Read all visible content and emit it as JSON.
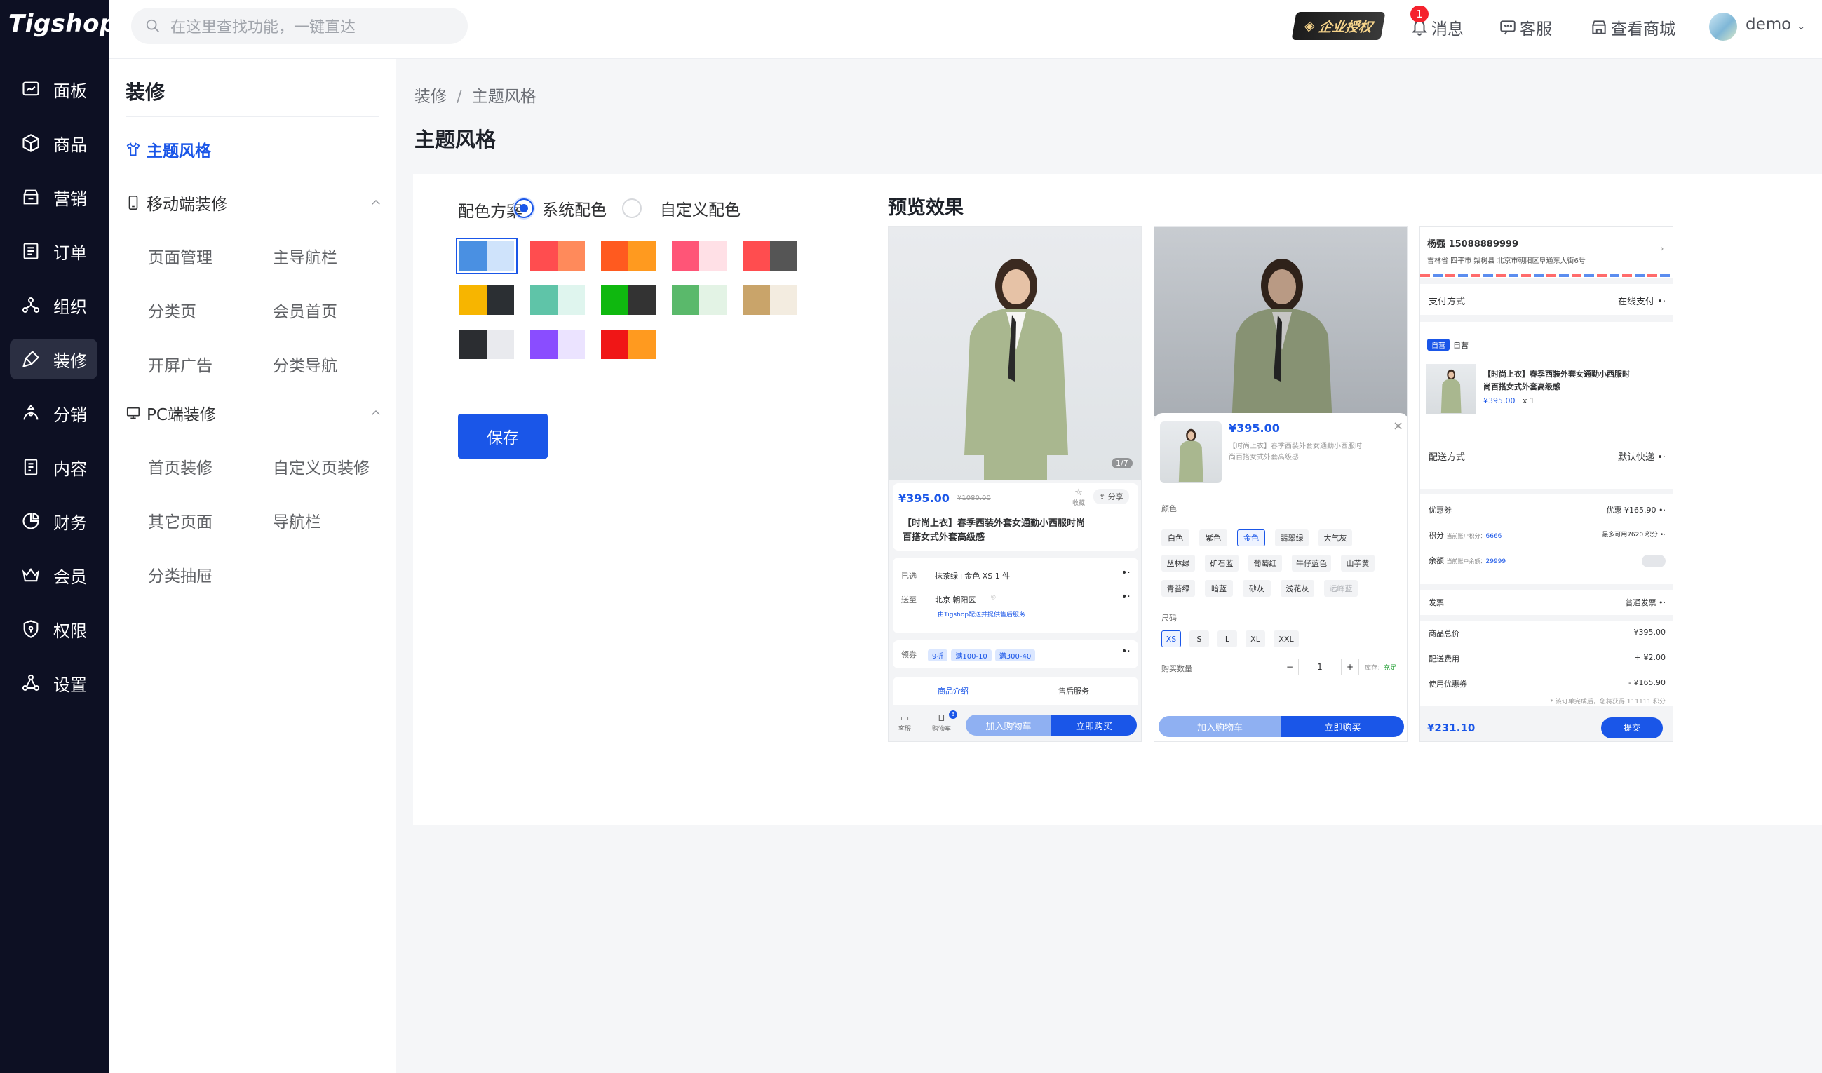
{
  "app": {
    "logo": "Tigshop"
  },
  "rail": [
    {
      "label": "面板",
      "icon": "dashboard-chart-icon"
    },
    {
      "label": "商品",
      "icon": "box-icon"
    },
    {
      "label": "营销",
      "icon": "marketing-shop-icon"
    },
    {
      "label": "订单",
      "icon": "order-list-icon"
    },
    {
      "label": "组织",
      "icon": "organization-icon"
    },
    {
      "label": "装修",
      "icon": "decoration-brush-icon",
      "active": true
    },
    {
      "label": "分销",
      "icon": "distribution-icon"
    },
    {
      "label": "内容",
      "icon": "content-doc-icon"
    },
    {
      "label": "财务",
      "icon": "finance-pie-icon"
    },
    {
      "label": "会员",
      "icon": "member-crown-icon"
    },
    {
      "label": "权限",
      "icon": "permission-shield-icon"
    },
    {
      "label": "设置",
      "icon": "settings-nodes-icon"
    }
  ],
  "topbar": {
    "search_placeholder": "在这里查找功能，一键直达",
    "enterprise_badge": "企业授权",
    "message_label": "消息",
    "message_count": "1",
    "service_label": "客服",
    "mall_label": "查看商城",
    "user_name": "demo"
  },
  "sidebar": {
    "title": "装修",
    "theme_label": "主题风格",
    "mobile_group": "移动端装修",
    "mobile_items": [
      "页面管理",
      "主导航栏",
      "分类页",
      "会员首页",
      "开屏广告",
      "分类导航"
    ],
    "pc_group": "PC端装修",
    "pc_items": [
      "首页装修",
      "自定义页装修",
      "其它页面",
      "导航栏",
      "分类抽屉"
    ]
  },
  "main": {
    "breadcrumb": [
      "装修",
      "主题风格"
    ],
    "title": "主题风格",
    "scheme_label": "配色方案",
    "radio_system": "系统配色",
    "radio_custom": "自定义配色",
    "save_label": "保存",
    "swatches": [
      [
        "#4a90e2",
        "#cfe3fb"
      ],
      [
        "#ff4d4f",
        "#ff8a5b"
      ],
      [
        "#ff5a1f",
        "#ff9a1f"
      ],
      [
        "#ff5577",
        "#ffe0e6"
      ],
      [
        "#ff4d4f",
        "#555555"
      ],
      [
        "#f7b500",
        "#2b2f33"
      ],
      [
        "#5fc4a8",
        "#dff5ee"
      ],
      [
        "#0fb80f",
        "#333333"
      ],
      [
        "#5ab96b",
        "#e3f3e5"
      ],
      [
        "#c9a46a",
        "#f3ece0"
      ],
      [
        "#2b2d31",
        "#e9eaee"
      ],
      [
        "#8a4dff",
        "#ebe3ff"
      ],
      [
        "#f01616",
        "#ff9a1f"
      ]
    ],
    "selected_swatch": 0
  },
  "preview": {
    "title": "预览效果",
    "p1": {
      "price": "¥395.00",
      "old_price": "¥1080.00",
      "page": "1/7",
      "fav": "收藏",
      "share": "分享",
      "name_line1": "【时尚上衣】春季西装外套女通勤小西服时尚",
      "name_line2": "百搭女式外套高级感",
      "sel_label": "已选",
      "sel_value": "抹茶绿+金色 XS 1 件",
      "ship_label": "送至",
      "ship_value": "北京 朝阳区",
      "ship_note": "由Tigshop配送并提供售后服务",
      "coupon_label": "领券",
      "coupons": [
        "9折",
        "满100-10",
        "满300-40"
      ],
      "tab_intro": "商品介绍",
      "tab_after": "售后服务",
      "nav_service": "客服",
      "nav_cart": "购物车",
      "cart_count": "3",
      "add_cart": "加入购物车",
      "buy_now": "立即购买"
    },
    "p2": {
      "price": "¥395.00",
      "desc_line1": "【时尚上衣】春季西装外套女通勤小西服时",
      "desc_line2": "尚百搭女式外套高级感",
      "color_label": "颜色",
      "colors": [
        "白色",
        "紫色",
        "金色",
        "翡翠绿",
        "大气灰",
        "丛林绿",
        "矿石蓝",
        "葡萄红",
        "牛仔蓝色",
        "山芋黄",
        "青苔绿",
        "暗蓝",
        "砂灰",
        "浅花灰",
        "远峰蓝"
      ],
      "size_label": "尺码",
      "sizes": [
        "XS",
        "S",
        "L",
        "XL",
        "XXL"
      ],
      "qty_label": "购买数量",
      "qty": "1",
      "stock_label": "库存：",
      "stock_value": "充足",
      "add_cart": "加入购物车",
      "buy_now": "立即购买"
    },
    "p3": {
      "name": "杨强 15088889999",
      "address": "吉林省 四平市 梨树县 北京市朝阳区阜通东大街6号",
      "pay_label": "支付方式",
      "pay_value": "在线支付",
      "shop_tag": "自营",
      "shop_name": "自营",
      "goods_line1": "【时尚上衣】春季西装外套女通勤小西服时",
      "goods_line2": "尚百搭女式外套高级感",
      "goods_price": "¥395.00",
      "goods_qty": "x 1",
      "delivery_label": "配送方式",
      "delivery_value": "默认快递",
      "coupon_label": "优惠券",
      "coupon_value": "优惠 ¥165.90",
      "points_label": "积分",
      "points_note": "当前账户积分：",
      "points_value": "6666",
      "points_max": "最多可用7620 积分",
      "balance_label": "余额",
      "balance_note": "当前账户余额：",
      "balance_value": "29999",
      "invoice_label": "发票",
      "invoice_value": "普通发票",
      "total_label": "商品总价",
      "total_value": "¥395.00",
      "fee_label": "配送费用",
      "fee_value": "+ ¥2.00",
      "used_label": "使用优惠券",
      "used_value": "- ¥165.90",
      "earn_note": "* 该订单完成后，您将获得 111111 积分",
      "pay_total": "¥231.10",
      "submit": "提交"
    }
  }
}
